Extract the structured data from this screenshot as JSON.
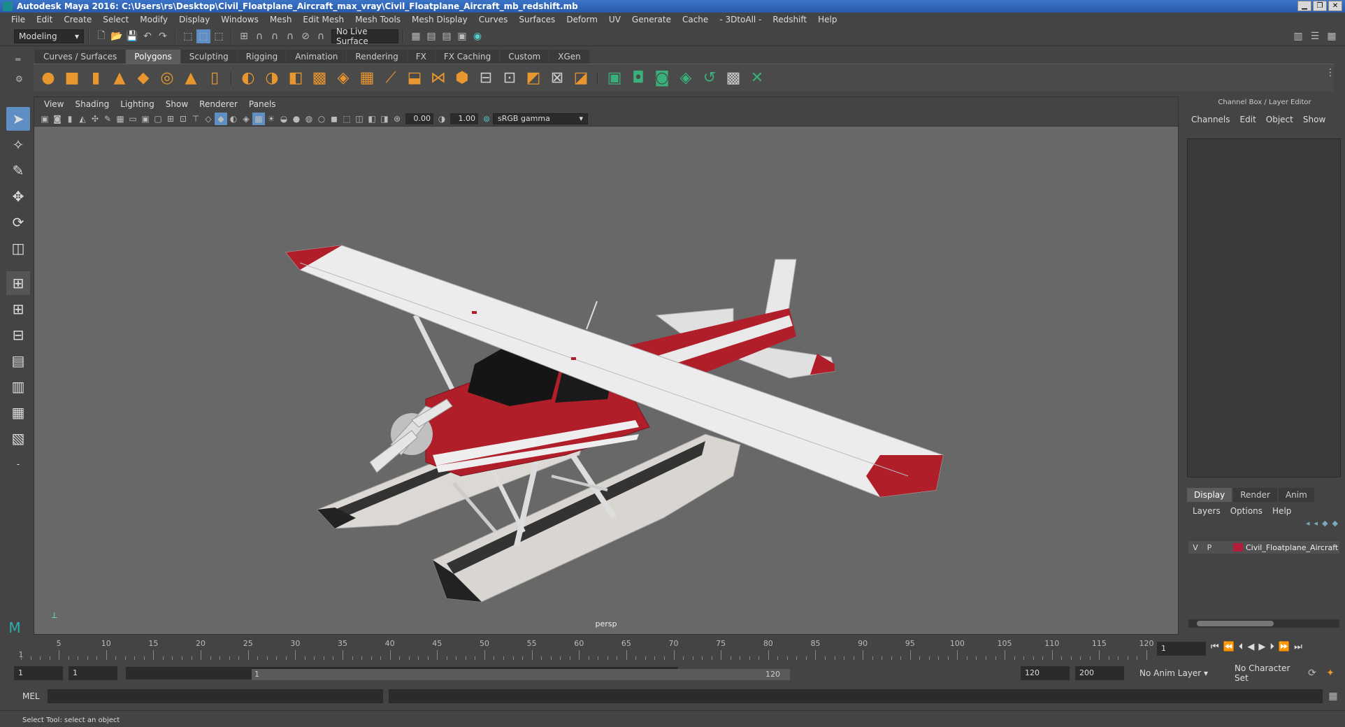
{
  "window": {
    "title": "Autodesk Maya 2016: C:\\Users\\rs\\Desktop\\Civil_Floatplane_Aircraft_max_vray\\Civil_Floatplane_Aircraft_mb_redshift.mb"
  },
  "menubar": [
    "File",
    "Edit",
    "Create",
    "Select",
    "Modify",
    "Display",
    "Windows",
    "Mesh",
    "Edit Mesh",
    "Mesh Tools",
    "Mesh Display",
    "Curves",
    "Surfaces",
    "Deform",
    "UV",
    "Generate",
    "Cache",
    "- 3DtoAll -",
    "Redshift",
    "Help"
  ],
  "statusline": {
    "mode": "Modeling",
    "live_surface": "No Live Surface"
  },
  "shelf_tabs": [
    "Curves / Surfaces",
    "Polygons",
    "Sculpting",
    "Rigging",
    "Animation",
    "Rendering",
    "FX",
    "FX Caching",
    "Custom",
    "XGen"
  ],
  "shelf_active": "Polygons",
  "viewport": {
    "menu": [
      "View",
      "Shading",
      "Lighting",
      "Show",
      "Renderer",
      "Panels"
    ],
    "exposure": "0.00",
    "gamma": "1.00",
    "color_space": "sRGB gamma",
    "camera": "persp"
  },
  "channel_box": {
    "title": "Channel Box / Layer Editor",
    "menu": [
      "Channels",
      "Edit",
      "Object",
      "Show"
    ]
  },
  "layer_editor": {
    "tabs": [
      "Display",
      "Render",
      "Anim"
    ],
    "active_tab": "Display",
    "menu": [
      "Layers",
      "Options",
      "Help"
    ],
    "layer": {
      "v": "V",
      "p": "P",
      "name": "Civil_Floatplane_Aircraft",
      "color": "#b01e3a"
    }
  },
  "timeline": {
    "ticks": [
      "5",
      "10",
      "15",
      "20",
      "25",
      "30",
      "35",
      "40",
      "45",
      "50",
      "55",
      "60",
      "65",
      "70",
      "75",
      "80",
      "85",
      "90",
      "95",
      "100",
      "105",
      "110",
      "115",
      "120"
    ],
    "current_frame": "1"
  },
  "range": {
    "start": "1",
    "playback_start": "1",
    "slider_start": "1",
    "slider_end": "120",
    "playback_end": "120",
    "end": "200",
    "anim_layer": "No Anim Layer",
    "character_set": "No Character Set"
  },
  "command_line": {
    "label": "MEL"
  },
  "help_line": "Select Tool: select an object"
}
